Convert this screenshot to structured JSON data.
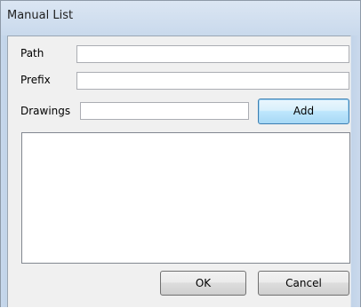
{
  "window": {
    "title": "Manual List"
  },
  "form": {
    "path_label": "Path",
    "path_value": "",
    "prefix_label": "Prefix",
    "prefix_value": "",
    "drawings_label": "Drawings",
    "drawings_value": "",
    "add_label": "Add"
  },
  "list": {
    "items": []
  },
  "footer": {
    "ok_label": "OK",
    "cancel_label": "Cancel"
  }
}
